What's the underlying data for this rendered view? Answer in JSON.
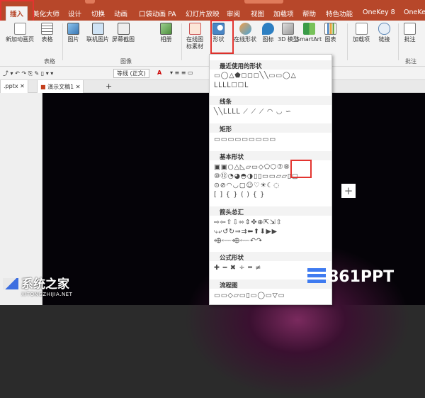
{
  "tabs": [
    "插入",
    "美化大师",
    "设计",
    "切换",
    "动画",
    "口袋动画 PA",
    "幻灯片放映",
    "审阅",
    "视图",
    "加载项",
    "帮助",
    "特色功能",
    "OneKey 8",
    "OneKe"
  ],
  "ribbon": {
    "buttons": [
      "新加动画页",
      "表格",
      "图片",
      "联机图片",
      "屏幕截图",
      "相册",
      "在线图标素材",
      "形状",
      "在线形状",
      "图标",
      "3D 模型",
      "SmartArt",
      "图表",
      "加载项",
      "链接",
      "批注"
    ],
    "groups": [
      "表格",
      "图像",
      "批注"
    ]
  },
  "format_bar": {
    "font": "等线 (正文)",
    "size": "A"
  },
  "doc_tabs": [
    ".pptx",
    "演示文稿1"
  ],
  "shapes_menu": {
    "sections": [
      {
        "title": "最近使用的形状",
        "rows": [
          "▭◯△⬟◻◻◻╲╲▭▭◯△",
          "ᒪᒪᒪᒪ☐☐ᒪ"
        ]
      },
      {
        "title": "线条",
        "rows": [
          "╲╲ᒪᒪᒪᒪ ⟋ ⟋ ⟋ ◠ ◡ ∽"
        ]
      },
      {
        "title": "矩形",
        "rows": [
          "▭▭▭▭▭▭▭▭▭"
        ]
      },
      {
        "title": "基本形状",
        "rows": [
          "▣▣○△◺▱▭◇⬠⬡⑦⑧",
          "⑩⑫◔◕◓◑▯▯▭▭▱▱▯▢",
          "⊙⊘◠◡▢☺♡☀☾◌",
          "[ ] { } ( ) { }"
        ]
      },
      {
        "title": "箭头总汇",
        "rows": [
          "⇨⇦⇧⇩⬄⇕✜⊕⇱⇲⇳",
          "⤷⤶↺↻⇒⇉⬅⬆⬇▶▶",
          "⬲⬳⬲⬳↶↷"
        ]
      },
      {
        "title": "公式形状",
        "rows": [
          "✚ ━ ✖ ÷ ═ ≠"
        ]
      },
      {
        "title": "流程图",
        "rows": [
          "▭▭◇▱▭▯▭◯▭▽▭"
        ]
      }
    ]
  },
  "watermarks": {
    "site1": "系统之家",
    "site1_sub": "XITONGZHIJIA.NET",
    "site2": "861PPT"
  }
}
